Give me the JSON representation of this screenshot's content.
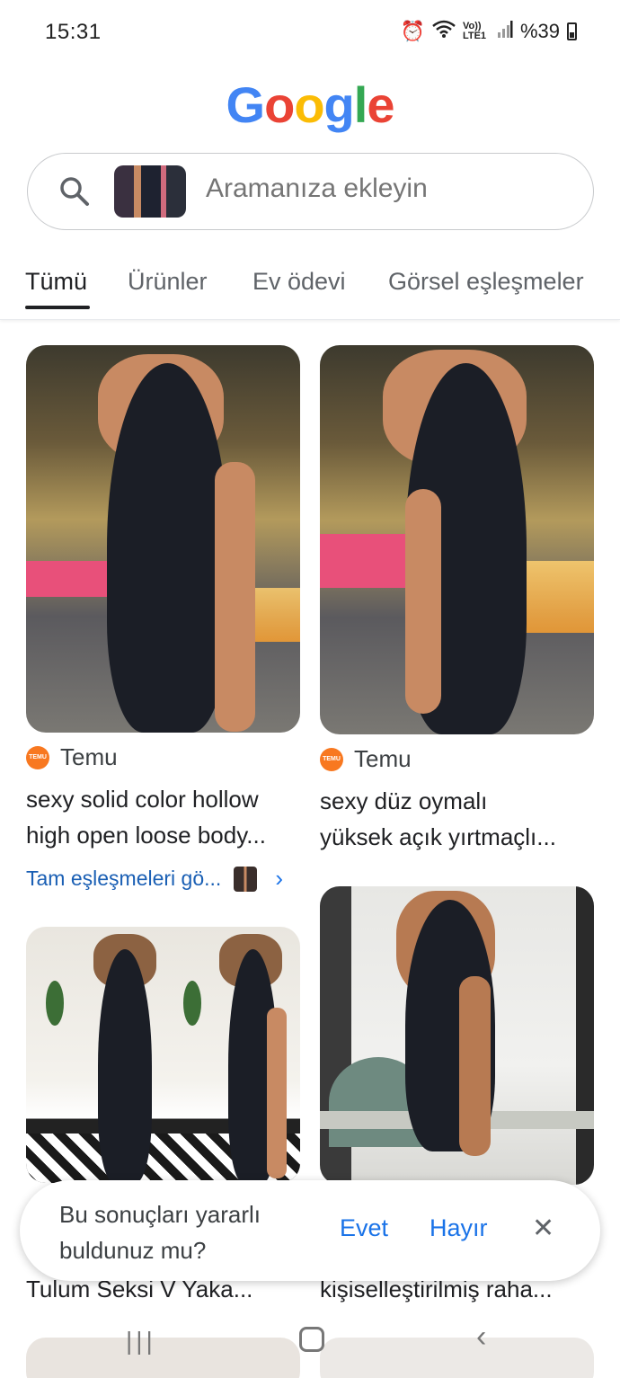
{
  "status_bar": {
    "time": "15:31",
    "volte": "Vo)) LTE1",
    "battery": "%39",
    "icons": [
      "alarm-icon",
      "wifi-icon",
      "signal-icon",
      "battery-icon"
    ]
  },
  "logo": {
    "letters": [
      "G",
      "o",
      "o",
      "g",
      "l",
      "e"
    ],
    "colors": [
      "#4285F4",
      "#EA4335",
      "#FBBC05",
      "#4285F4",
      "#34A853",
      "#EA4335"
    ]
  },
  "search": {
    "placeholder": "Aramanıza ekleyin"
  },
  "tabs": [
    {
      "label": "Tümü"
    },
    {
      "label": "Ürünler"
    },
    {
      "label": "Ev ödevi"
    },
    {
      "label": "Görsel eşleşmeler"
    }
  ],
  "results": [
    {
      "source": "Temu",
      "line1": "sexy solid color hollow",
      "line2": "high open loose body..."
    },
    {
      "source": "Temu",
      "line1": "sexy düz oymalı",
      "line2": "yüksek açık yırtmaçlı..."
    },
    {
      "line2": "Tulum Seksi V Yaka..."
    },
    {
      "line2": "kişiselleştirilmiş raha..."
    }
  ],
  "exact_match_link": "Tam eşleşmeleri gö...",
  "feedback": {
    "question": "Bu sonuçları yararlı buldunuz mu?",
    "yes": "Evet",
    "no": "Hayır",
    "close": "✕"
  },
  "temu_icon_text": "TEMU",
  "colors": {
    "link_blue": "#1a73e8",
    "temu_orange": "#f87820"
  }
}
